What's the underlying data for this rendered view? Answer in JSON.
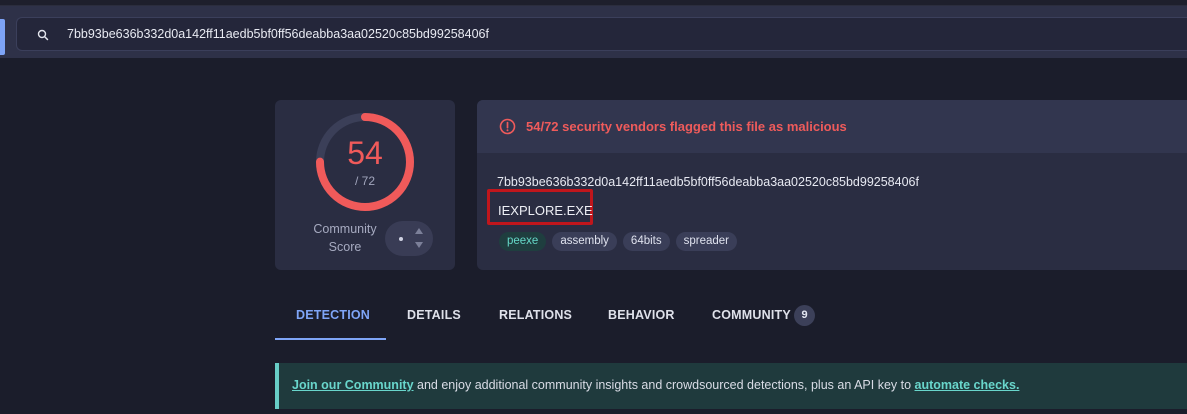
{
  "search": {
    "value": "7bb93be636b332d0a142ff11aedb5bf0ff56deabba3aa02520c85bd99258406f",
    "icon": "search-icon"
  },
  "score": {
    "detected": "54",
    "total": "/ 72",
    "detection_ratio": 0.75,
    "label_line1": "Community",
    "label_line2": "Score",
    "gauge_color": "#f05a5a"
  },
  "alert": {
    "text": "54/72 security vendors flagged this file as malicious",
    "color": "#ef5b5b"
  },
  "file": {
    "hash": "7bb93be636b332d0a142ff11aedb5bf0ff56deabba3aa02520c85bd99258406f",
    "name": "IEXPLORE.EXE",
    "tags": [
      "peexe",
      "assembly",
      "64bits",
      "spreader"
    ]
  },
  "tabs": [
    {
      "label": "DETECTION",
      "active": true
    },
    {
      "label": "DETAILS",
      "active": false
    },
    {
      "label": "RELATIONS",
      "active": false
    },
    {
      "label": "BEHAVIOR",
      "active": false
    },
    {
      "label": "COMMUNITY",
      "active": false,
      "badge": "9"
    }
  ],
  "banner": {
    "link1": "Join our Community",
    "middle": " and enjoy additional community insights and crowdsourced detections, plus an API key to ",
    "link2": "automate checks."
  },
  "colors": {
    "accent": "#7fa5f7",
    "malicious": "#ef5b5b",
    "teal": "#69d6cc"
  }
}
